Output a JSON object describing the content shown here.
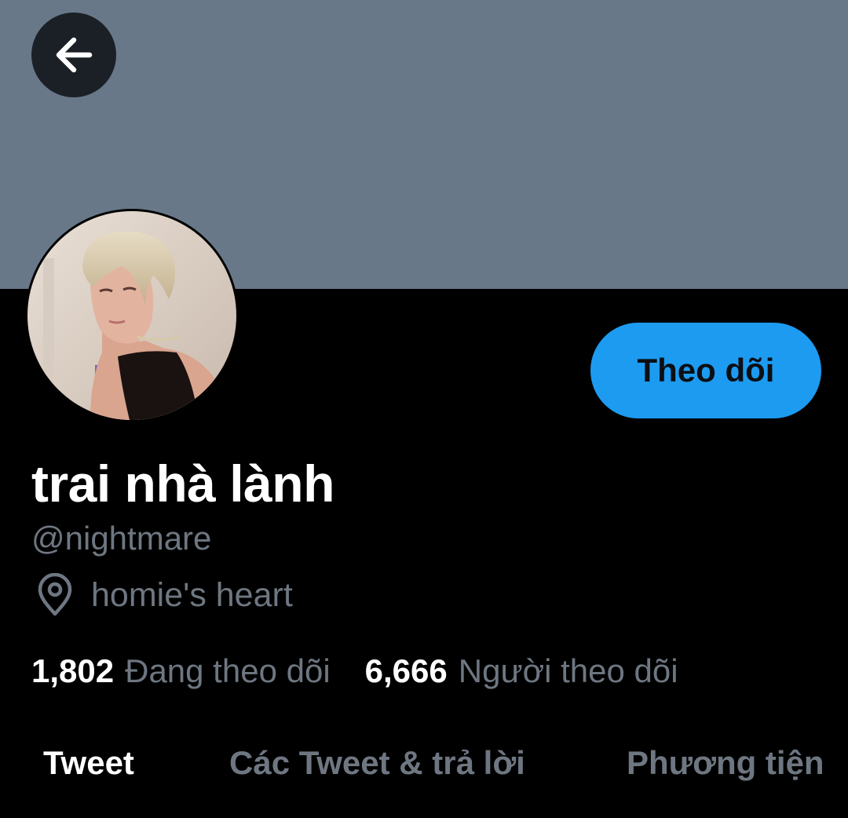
{
  "header": {
    "back_icon": "arrow-left-icon",
    "banner_color": "#687889"
  },
  "profile": {
    "display_name": "trai nhà lành",
    "handle": "@nightmare",
    "location": "homie's heart",
    "location_icon": "location-pin-icon",
    "follow_label": "Theo dõi",
    "accent_color": "#1d9bf0"
  },
  "stats": {
    "following_count": "1,802",
    "following_label": "Đang theo dõi",
    "followers_count": "6,666",
    "followers_label": "Người theo dõi"
  },
  "tabs": [
    {
      "label": "Tweet",
      "active": true
    },
    {
      "label": "Các Tweet & trả lời",
      "active": false
    },
    {
      "label": "Phương tiện",
      "active": false
    }
  ]
}
